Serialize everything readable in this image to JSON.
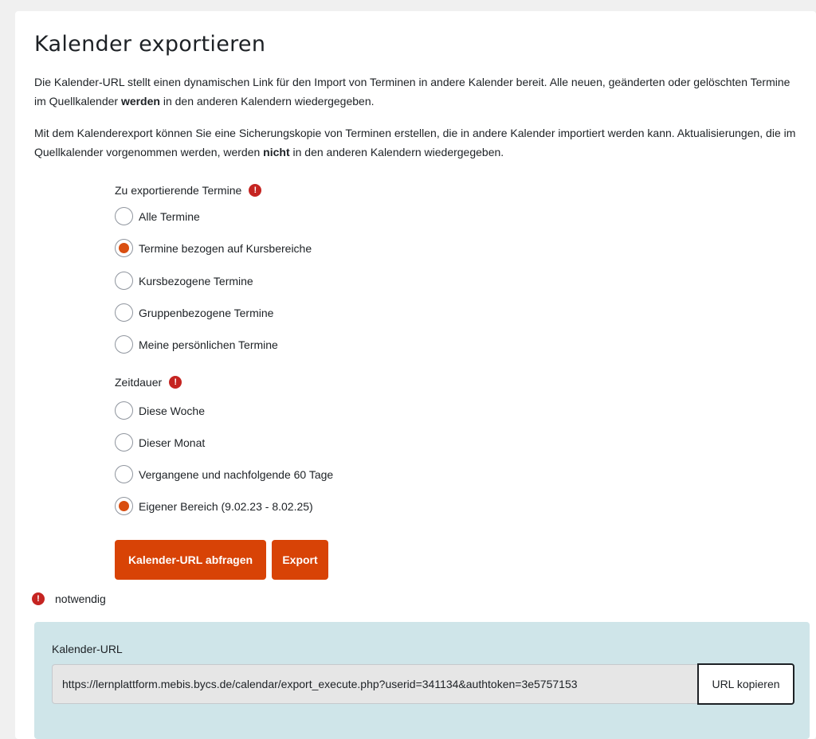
{
  "title": "Kalender exportieren",
  "intro": {
    "p1_a": "Die Kalender-URL stellt einen dynamischen Link für den Import von Terminen in andere Kalender bereit. Alle neuen, geänderten oder gelöschten Termine im Quellkalender ",
    "p1_bold": "werden",
    "p1_b": " in den anderen Kalendern wiedergegeben.",
    "p2_a": "Mit dem Kalenderexport können Sie eine Sicherungskopie von Terminen erstellen, die in andere Kalender importiert werden kann. Aktualisierungen, die im Quellkalender vorgenommen werden, werden ",
    "p2_bold": "nicht",
    "p2_b": " in den anderen Kalendern wiedergegeben."
  },
  "events_group": {
    "label": "Zu exportierende Termine",
    "required_icon": "exclamation-circle-icon",
    "options": [
      {
        "label": "Alle Termine",
        "checked": false
      },
      {
        "label": "Termine bezogen auf Kursbereiche",
        "checked": true
      },
      {
        "label": "Kursbezogene Termine",
        "checked": false
      },
      {
        "label": "Gruppenbezogene Termine",
        "checked": false
      },
      {
        "label": "Meine persönlichen Termine",
        "checked": false
      }
    ]
  },
  "period_group": {
    "label": "Zeitdauer",
    "required_icon": "exclamation-circle-icon",
    "options": [
      {
        "label": "Diese Woche",
        "checked": false
      },
      {
        "label": "Dieser Monat",
        "checked": false
      },
      {
        "label": "Vergangene und nachfolgende 60 Tage",
        "checked": false
      },
      {
        "label": "Eigener Bereich (9.02.23 - 8.02.25)",
        "checked": true
      }
    ]
  },
  "buttons": {
    "get_url": "Kalender-URL abfragen",
    "export": "Export"
  },
  "required_note": "notwendig",
  "calendar_url": {
    "label": "Kalender-URL",
    "value": "https://lernplattform.mebis.bycs.de/calendar/export_execute.php?userid=341134&authtoken=3e5757153",
    "copy_label": "URL kopieren"
  },
  "colors": {
    "accent": "#d84306",
    "required": "#c52421",
    "url_box_bg": "#cfe5e9"
  }
}
